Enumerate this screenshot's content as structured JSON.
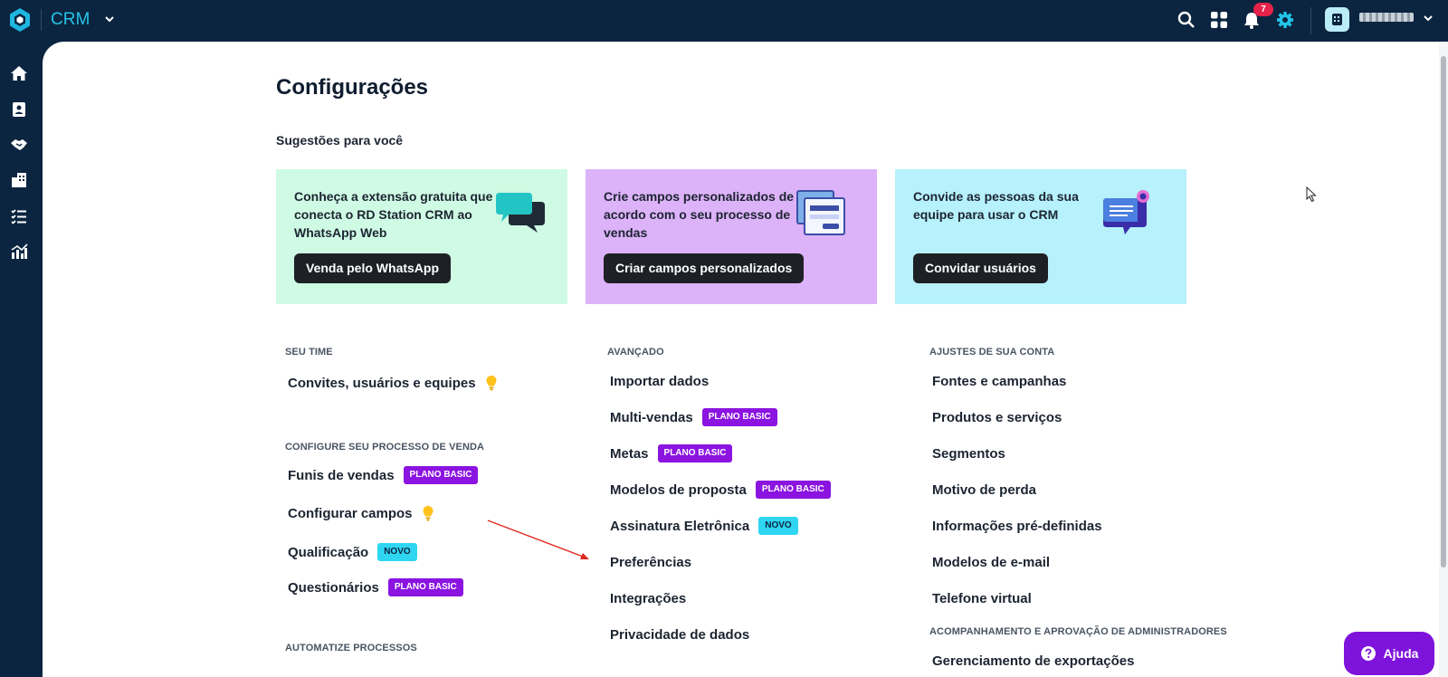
{
  "topbar": {
    "app_name": "CRM",
    "notifications_count": "7",
    "icons": [
      "logo-icon",
      "chevron-down-icon",
      "search-icon",
      "apps-grid-icon",
      "bell-icon",
      "gear-icon",
      "user-avatar-icon"
    ]
  },
  "sidebar": {
    "items": [
      {
        "name": "home",
        "icon": "home-icon"
      },
      {
        "name": "contacts",
        "icon": "contacts-icon"
      },
      {
        "name": "deals",
        "icon": "handshake-icon"
      },
      {
        "name": "companies",
        "icon": "building-icon"
      },
      {
        "name": "tasks",
        "icon": "tasks-icon"
      },
      {
        "name": "reports",
        "icon": "chart-icon"
      }
    ]
  },
  "main": {
    "title": "Configurações",
    "suggestions_title": "Sugestões para você",
    "cards": [
      {
        "text": "Conheça a extensão gratuita que conecta o RD Station CRM ao WhatsApp Web",
        "button": "Venda pelo WhatsApp",
        "bg": "#cffbe4",
        "icon": "chat-bubbles-icon"
      },
      {
        "text": "Crie campos personalizados de acordo com o seu processo de vendas",
        "button": "Criar campos personalizados",
        "bg": "#dcb2f8",
        "icon": "custom-fields-icon"
      },
      {
        "text": "Convide as pessoas da sua equipe para usar o CRM",
        "button": "Convidar usuários",
        "bg": "#b6f1fc",
        "icon": "invite-message-icon"
      }
    ],
    "sections": {
      "seu_time": {
        "title": "SEU TIME",
        "items": [
          {
            "label": "Convites, usuários e equipes",
            "bulb": true
          }
        ]
      },
      "processo_venda": {
        "title": "CONFIGURE SEU PROCESSO DE VENDA",
        "items": [
          {
            "label": "Funis de vendas",
            "badge": "PLANO BASIC"
          },
          {
            "label": "Configurar campos",
            "bulb": true
          },
          {
            "label": "Qualificação",
            "badge": "NOVO"
          },
          {
            "label": "Questionários",
            "badge": "PLANO BASIC"
          }
        ]
      },
      "automatize": {
        "title": "AUTOMATIZE PROCESSOS"
      },
      "avancado": {
        "title": "AVANÇADO",
        "items": [
          {
            "label": "Importar dados"
          },
          {
            "label": "Multi-vendas",
            "badge": "PLANO BASIC"
          },
          {
            "label": "Metas",
            "badge": "PLANO BASIC"
          },
          {
            "label": "Modelos de proposta",
            "badge": "PLANO BASIC"
          },
          {
            "label": "Assinatura Eletrônica",
            "badge": "NOVO"
          },
          {
            "label": "Preferências"
          },
          {
            "label": "Integrações"
          },
          {
            "label": "Privacidade de dados"
          }
        ]
      },
      "ajustes_conta": {
        "title": "AJUSTES DE SUA CONTA",
        "items": [
          {
            "label": "Fontes e campanhas"
          },
          {
            "label": "Produtos e serviços"
          },
          {
            "label": "Segmentos"
          },
          {
            "label": "Motivo de perda"
          },
          {
            "label": "Informações pré-definidas"
          },
          {
            "label": "Modelos de e-mail"
          },
          {
            "label": "Telefone virtual"
          }
        ]
      },
      "acompanhamento": {
        "title": "ACOMPANHAMENTO E APROVAÇÃO DE ADMINISTRADORES",
        "items": [
          {
            "label": "Gerenciamento de exportações"
          }
        ]
      }
    }
  },
  "help": {
    "label": "Ajuda",
    "icon": "question-circle-icon"
  },
  "colors": {
    "brand_dark": "#0b2540",
    "accent_cyan": "#23c4e8",
    "plan_purple": "#8b14e0",
    "new_cyan": "#2fd6f2",
    "help_purple": "#7e13db",
    "annotation_red": "#e0281f"
  }
}
